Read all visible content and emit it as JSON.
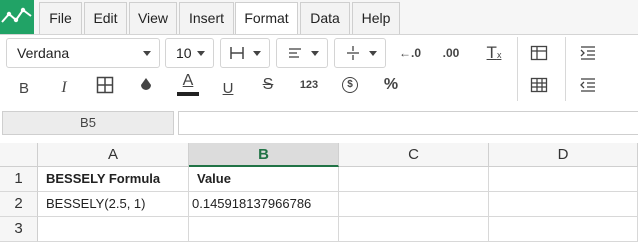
{
  "menu": {
    "tabs": [
      {
        "label": "File"
      },
      {
        "label": "Edit"
      },
      {
        "label": "View"
      },
      {
        "label": "Insert"
      },
      {
        "label": "Format"
      },
      {
        "label": "Data"
      },
      {
        "label": "Help"
      }
    ],
    "active_tab": "Format"
  },
  "toolbar": {
    "font_family": "Verdana",
    "font_size": "10",
    "number_format_label": "123",
    "percent_label": "%",
    "currency_label": "$",
    "bold_label": "B",
    "italic_label": "I",
    "underline_label": "U",
    "strike_label": "S",
    "text_color_label": "A",
    "text_color": "#222222"
  },
  "formula_bar": {
    "name_box": "B5",
    "formula": ""
  },
  "sheet": {
    "columns": [
      "A",
      "B",
      "C",
      "D"
    ],
    "selected_column": "B",
    "rows": [
      {
        "num": "1",
        "cells": [
          "BESSELY Formula",
          "Value",
          "",
          ""
        ]
      },
      {
        "num": "2",
        "cells": [
          "BESSELY(2.5, 1)",
          "0.145918137966786",
          "",
          ""
        ]
      },
      {
        "num": "3",
        "cells": [
          "",
          "",
          "",
          ""
        ]
      }
    ]
  },
  "colors": {
    "accent": "#217346",
    "logo": "#21a366"
  }
}
